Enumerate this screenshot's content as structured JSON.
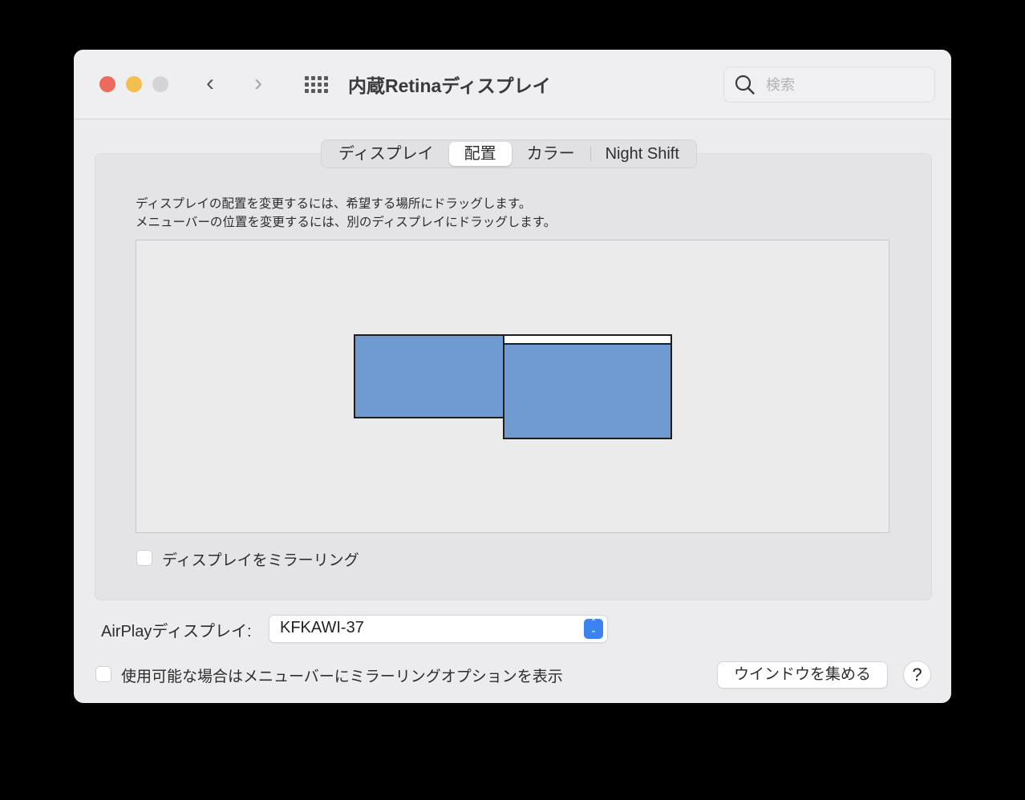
{
  "window": {
    "title": "内蔵Retinaディスプレイ",
    "search_placeholder": "検索",
    "back_label": "‹",
    "forward_label": "›"
  },
  "tabs": [
    {
      "label": "ディスプレイ",
      "active": false
    },
    {
      "label": "配置",
      "active": true
    },
    {
      "label": "カラー",
      "active": false
    },
    {
      "label": "Night Shift",
      "active": false
    }
  ],
  "arrangement": {
    "instruction_line1": "ディスプレイの配置を変更するには、希望する場所にドラッグします。",
    "instruction_line2": "メニューバーの位置を変更するには、別のディスプレイにドラッグします。",
    "displays": [
      {
        "name": "secondary-display",
        "has_menubar": false
      },
      {
        "name": "main-display",
        "has_menubar": true
      }
    ],
    "display_color": "#6f9bd2",
    "mirror_label": "ディスプレイをミラーリング",
    "mirror_checked": false
  },
  "airplay": {
    "label": "AirPlayディスプレイ:",
    "selected": "KFKAWI-37"
  },
  "footer": {
    "show_options_label": "使用可能な場合はメニューバーにミラーリングオプションを表示",
    "show_options_checked": false,
    "gather_button": "ウインドウを集める",
    "help_button": "?"
  }
}
